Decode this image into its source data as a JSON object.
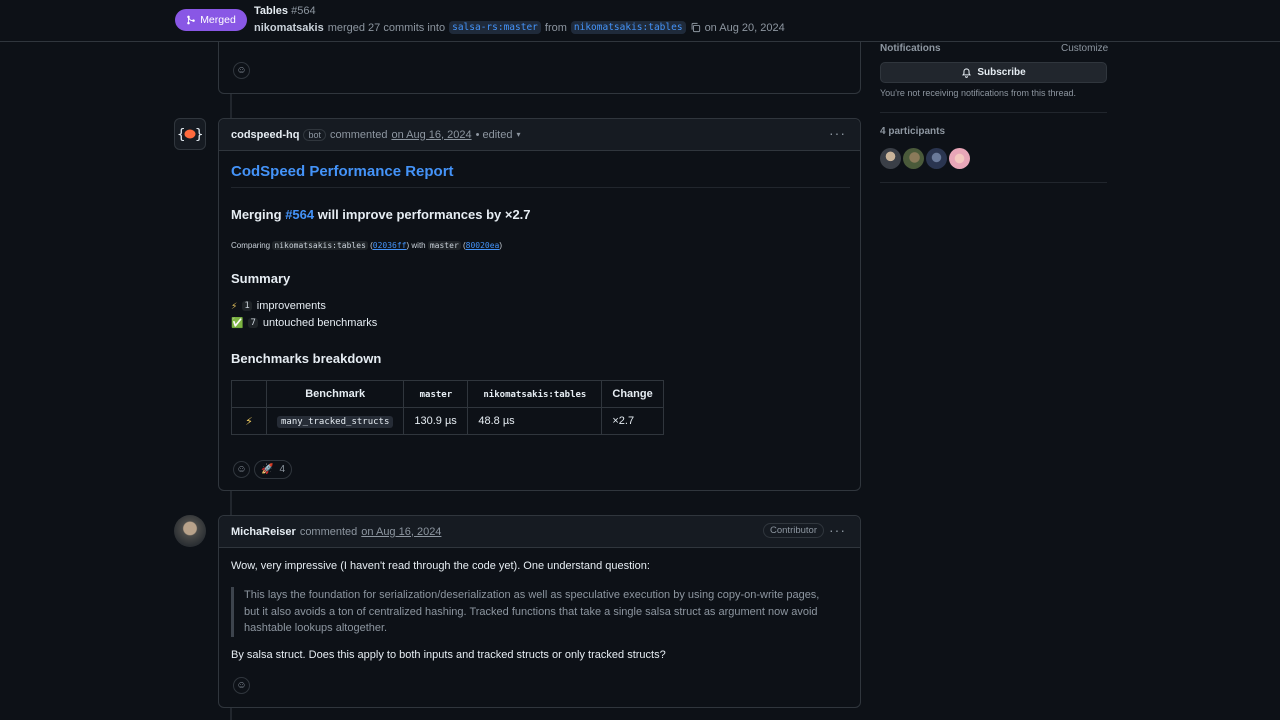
{
  "header": {
    "badge_label": "Merged",
    "title": "Tables",
    "number": "#564",
    "author": "nikomatsakis",
    "merged_text": "merged 27 commits into",
    "base_branch": "salsa-rs:master",
    "from_text": "from",
    "head_branch": "nikomatsakis:tables",
    "date_text": "on Aug 20, 2024"
  },
  "sidebar": {
    "notifications_label": "Notifications",
    "customize_label": "Customize",
    "subscribe_label": "Subscribe",
    "subscribe_note": "You're not receiving notifications from this thread.",
    "participants_label": "4 participants",
    "participant_avatars": [
      "participant-avatar-1",
      "participant-avatar-2",
      "participant-avatar-3",
      "participant-avatar-4"
    ]
  },
  "comment_bot": {
    "author": "codspeed-hq",
    "bot_label": "bot",
    "commented": "commented",
    "time": "on Aug 16, 2024",
    "edited": "• edited",
    "report_title": "CodSpeed Performance Report",
    "merging_prefix": "Merging",
    "merging_pr": "#564",
    "merging_suffix": "will improve performances by ×2.7",
    "comparing_label": "Comparing",
    "comparing_branch": "nikomatsakis:tables",
    "comparing_hash": "02036ff",
    "with_label": "with",
    "master_label": "master",
    "master_hash": "80020ea",
    "summary_heading": "Summary",
    "summary_items": [
      {
        "icon": "⚡",
        "count": "1",
        "text": "improvements"
      },
      {
        "icon": "✅",
        "count": "7",
        "text": "untouched benchmarks"
      }
    ],
    "breakdown_heading": "Benchmarks breakdown",
    "table_headers": [
      "",
      "Benchmark",
      "master",
      "nikomatsakis:tables",
      "Change"
    ],
    "table_rows": [
      {
        "icon": "⚡",
        "benchmark": "many_tracked_structs",
        "master": "130.9 µs",
        "branch": "48.8 µs",
        "change": "×2.7"
      }
    ],
    "reaction_emoji": "🚀",
    "reaction_count": "4"
  },
  "comment_user": {
    "author": "MichaReiser",
    "commented": "commented",
    "time": "on Aug 16, 2024",
    "role_badge": "Contributor",
    "body_intro": "Wow, very impressive (I haven't read through the code yet). One understand question:",
    "quote": "This lays the foundation for serialization/deserialization as well as speculative execution by using copy-on-write pages, but it also avoids a ton of centralized hashing. Tracked functions that take a single salsa struct as argument now avoid hashtable lookups altogether.",
    "body_question": "By salsa struct. Does this apply to both inputs and tracked structs or only tracked structs?"
  },
  "colors": {
    "accent": "#4493f8",
    "merged": "#8957e5",
    "background": "#0d1117",
    "border": "#30363d"
  }
}
